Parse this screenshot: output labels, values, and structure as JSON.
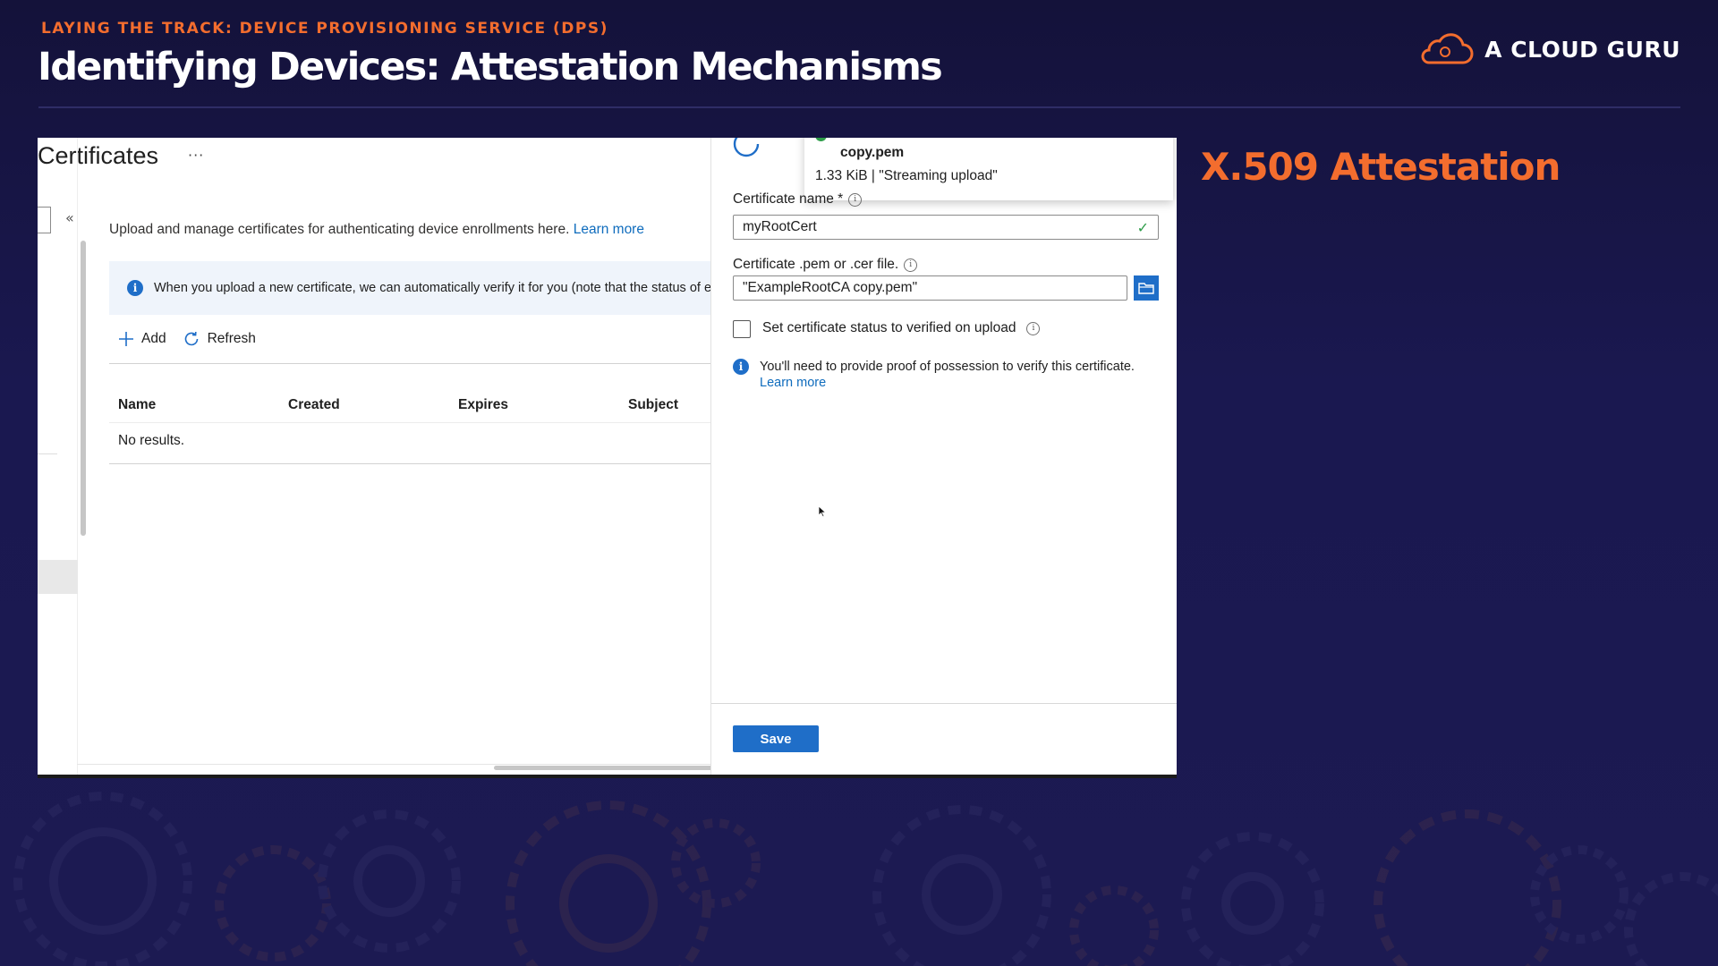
{
  "slide": {
    "eyebrow": "LAYING THE TRACK: DEVICE PROVISIONING SERVICE (DPS)",
    "title": "Identifying Devices: Attestation Mechanisms",
    "logo_text": "A CLOUD GURU",
    "side_heading": "X.509 Attestation",
    "accent_color": "#f36d2e",
    "background_color": "#1a1850"
  },
  "blade": {
    "title": "Certificates",
    "more": "···",
    "collapse": "«",
    "description": "Upload and manage certificates for authenticating device enrollments here.",
    "learn_more": "Learn more",
    "banner_text": "When you upload a new certificate, we can automatically verify it for you (note that the status of ex",
    "toolbar": {
      "add": "Add",
      "refresh": "Refresh"
    },
    "columns": [
      "Name",
      "Created",
      "Expires",
      "Subject"
    ],
    "empty_text": "No results."
  },
  "upload_pane": {
    "toast": {
      "filename": "copy.pem",
      "meta": "1.33 KiB | \"Streaming upload\""
    },
    "cert_name_label": "Certificate name *",
    "cert_name_value": "myRootCert",
    "file_label": "Certificate .pem or .cer file.",
    "file_value": "\"ExampleRootCA copy.pem\"",
    "verify_label": "Set certificate status to verified on upload",
    "possession_text": "You'll need to provide proof of possession to verify this certificate.",
    "possession_link": "Learn more",
    "save_label": "Save",
    "primary_color": "#1f6ec8"
  }
}
